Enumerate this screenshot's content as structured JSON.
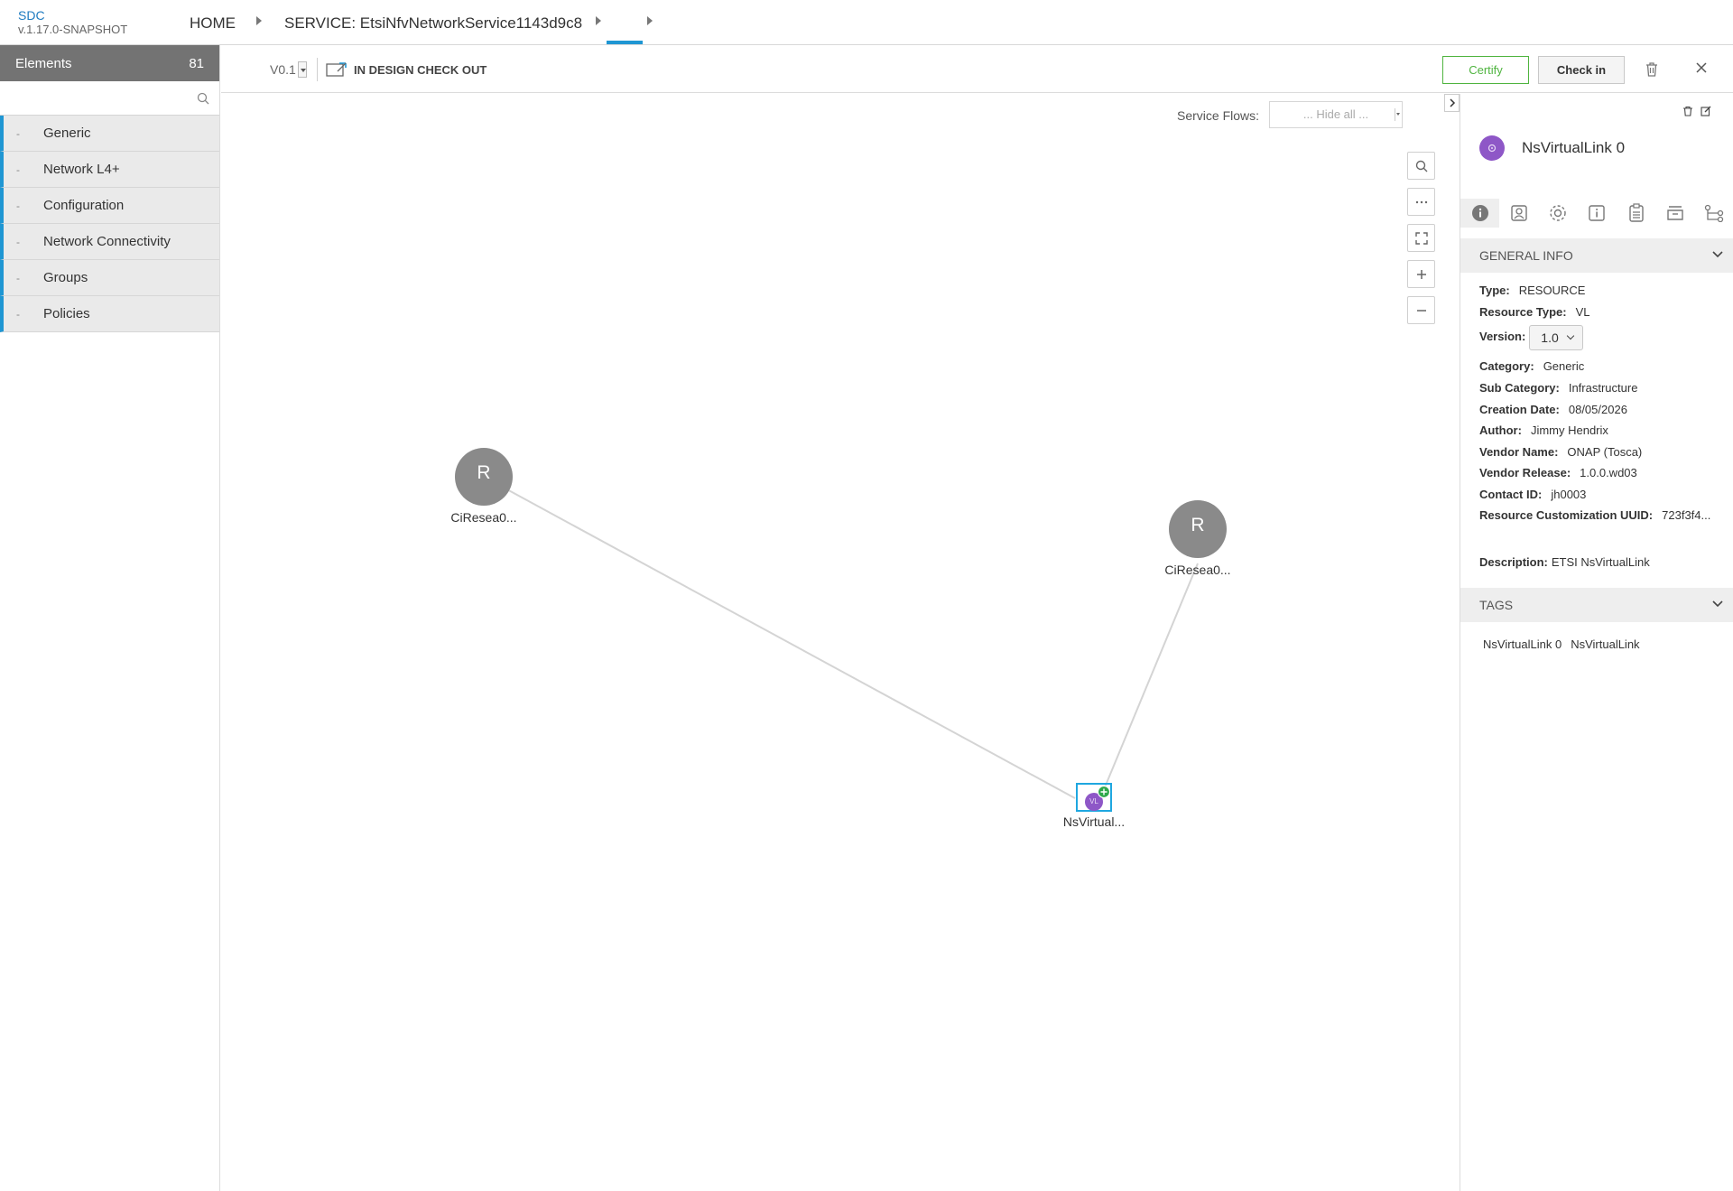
{
  "header": {
    "app_name": "SDC",
    "app_version": "v.1.17.0-SNAPSHOT",
    "breadcrumb": [
      "HOME",
      "SERVICE: EtsiNfvNetworkService1143d9c8",
      ""
    ]
  },
  "palette": {
    "title": "Elements",
    "count": "81",
    "search_placeholder": "",
    "groups": [
      "Generic",
      "Network L4+",
      "Configuration",
      "Network Connectivity",
      "Groups",
      "Policies"
    ]
  },
  "toolbar": {
    "version": "V0.1",
    "status": "IN DESIGN CHECK OUT",
    "certify_label": "Certify",
    "checkin_label": "Check in"
  },
  "canvas": {
    "service_flows_label": "Service Flows:",
    "service_flows_value": "... Hide all ...",
    "nodes": [
      {
        "letter": "R",
        "label": "CiResea0..."
      },
      {
        "letter": "R",
        "label": "CiResea0..."
      },
      {
        "letter": "VL",
        "label": "NsVirtual..."
      }
    ]
  },
  "details": {
    "title": "NsVirtualLink 0",
    "general_info_title": "GENERAL INFO",
    "info": [
      {
        "key": "Type:",
        "value": "RESOURCE"
      },
      {
        "key": "Resource Type:",
        "value": "VL"
      },
      {
        "key": "Version:",
        "value": "1.0"
      },
      {
        "key": "Category:",
        "value": "Generic"
      },
      {
        "key": "Sub Category:",
        "value": "Infrastructure"
      },
      {
        "key": "Creation Date:",
        "value": "08/05/2026"
      },
      {
        "key": "Author:",
        "value": "Jimmy Hendrix"
      },
      {
        "key": "Vendor Name:",
        "value": "ONAP (Tosca)"
      },
      {
        "key": "Vendor Release:",
        "value": "1.0.0.wd03"
      },
      {
        "key": "Contact ID:",
        "value": "jh0003"
      },
      {
        "key": "Resource Customization UUID:",
        "value": "723f3f4..."
      }
    ],
    "description_key": "Description:",
    "description_value": "ETSI NsVirtualLink",
    "tags_title": "TAGS",
    "tags": [
      "NsVirtualLink 0",
      "NsVirtualLink"
    ]
  },
  "colors": {
    "accent": "#1f96d3",
    "certify": "#4fb43f",
    "vl_purple": "#8e57c7",
    "node_gray": "#8a8a8a"
  }
}
